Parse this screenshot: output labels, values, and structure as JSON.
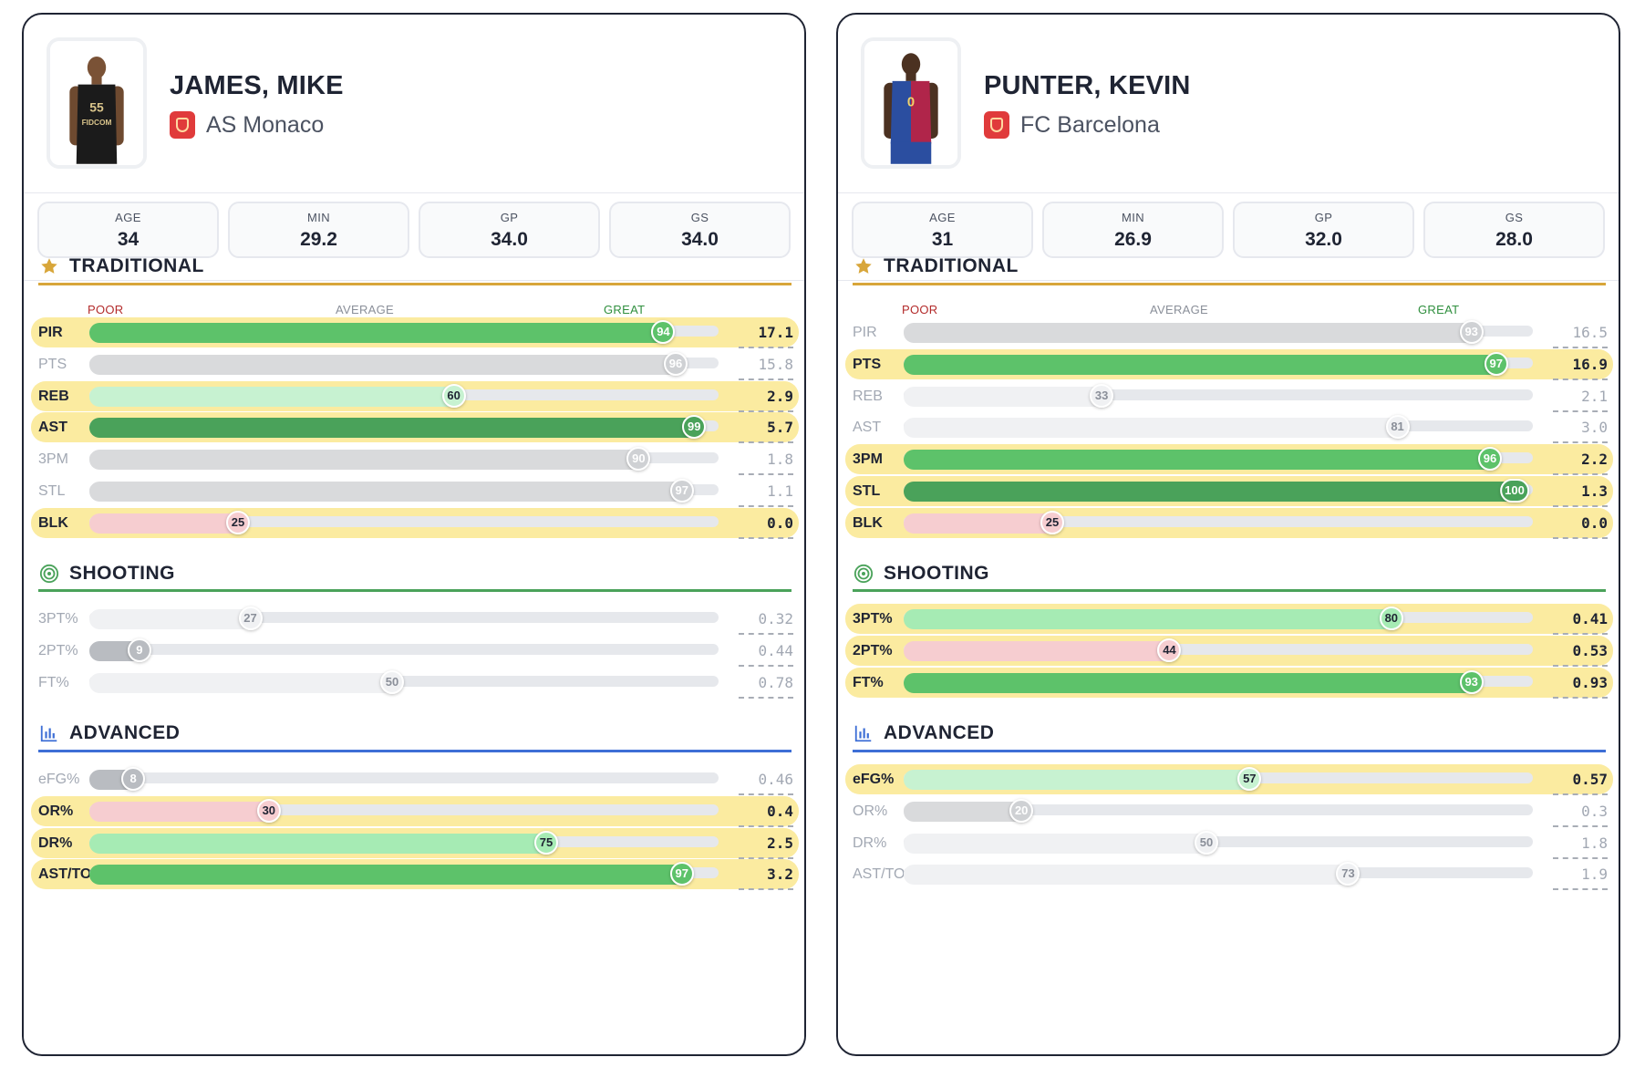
{
  "colors": {
    "great_dark": "#4aa25a",
    "great": "#5dc26a",
    "good": "#a6ebb4",
    "above": "#c7f2d1",
    "poor": "#f6cdd0",
    "neutral": "#d9dadc",
    "neutral_badge": "#cfd1d4",
    "neutral_light": "#f0f1f3",
    "highlight": "#fbeba0",
    "traditional_accent": "#d8a63a",
    "shooting_accent": "#4aa25a",
    "advanced_accent": "#3e6fd6",
    "poor_text": "#b32b2b",
    "great_text": "#2f8f3e",
    "average_text": "#8a8f99"
  },
  "icons": {
    "traditional": "star-icon",
    "shooting": "target-icon",
    "advanced": "bar-chart-icon"
  },
  "players": [
    {
      "name": "JAMES, MIKE",
      "team": "AS Monaco",
      "jersey": "55",
      "jersey_text": "FIDCOM",
      "jersey_color": "#1b1b1b",
      "stats": [
        {
          "label": "AGE",
          "value": "34"
        },
        {
          "label": "MIN",
          "value": "29.2"
        },
        {
          "label": "GP",
          "value": "34.0"
        },
        {
          "label": "GS",
          "value": "34.0"
        }
      ],
      "sections": [
        {
          "key": "traditional",
          "title": "TRADITIONAL",
          "scale": {
            "poor": "POOR",
            "average": "AVERAGE",
            "great": "GREAT"
          },
          "rows": [
            {
              "label": "PIR",
              "pct": 94,
              "value": "17.1",
              "hl": true,
              "tone": "great"
            },
            {
              "label": "PTS",
              "pct": 96,
              "value": "15.8",
              "hl": false,
              "tone": "neutral"
            },
            {
              "label": "REB",
              "pct": 60,
              "value": "2.9",
              "hl": true,
              "tone": "above"
            },
            {
              "label": "AST",
              "pct": 99,
              "value": "5.7",
              "hl": true,
              "tone": "great_dark"
            },
            {
              "label": "3PM",
              "pct": 90,
              "value": "1.8",
              "hl": false,
              "tone": "neutral"
            },
            {
              "label": "STL",
              "pct": 97,
              "value": "1.1",
              "hl": false,
              "tone": "neutral"
            },
            {
              "label": "BLK",
              "pct": 25,
              "value": "0.0",
              "hl": true,
              "tone": "poor"
            }
          ]
        },
        {
          "key": "shooting",
          "title": "SHOOTING",
          "rows": [
            {
              "label": "3PT%",
              "pct": 27,
              "value": "0.32",
              "hl": false,
              "tone": "neutral_light"
            },
            {
              "label": "2PT%",
              "pct": 9,
              "value": "0.44",
              "hl": false,
              "tone": "neutral_dark"
            },
            {
              "label": "FT%",
              "pct": 50,
              "value": "0.78",
              "hl": false,
              "tone": "neutral_light"
            }
          ]
        },
        {
          "key": "advanced",
          "title": "ADVANCED",
          "rows": [
            {
              "label": "eFG%",
              "pct": 8,
              "value": "0.46",
              "hl": false,
              "tone": "neutral_dark"
            },
            {
              "label": "OR%",
              "pct": 30,
              "value": "0.4",
              "hl": true,
              "tone": "poor"
            },
            {
              "label": "DR%",
              "pct": 75,
              "value": "2.5",
              "hl": true,
              "tone": "good"
            },
            {
              "label": "AST/TO",
              "pct": 97,
              "value": "3.2",
              "hl": true,
              "tone": "great"
            }
          ]
        }
      ]
    },
    {
      "name": "PUNTER, KEVIN",
      "team": "FC Barcelona",
      "jersey": "0",
      "jersey_text": "",
      "jersey_color": "#b0254a",
      "stats": [
        {
          "label": "AGE",
          "value": "31"
        },
        {
          "label": "MIN",
          "value": "26.9"
        },
        {
          "label": "GP",
          "value": "32.0"
        },
        {
          "label": "GS",
          "value": "28.0"
        }
      ],
      "sections": [
        {
          "key": "traditional",
          "title": "TRADITIONAL",
          "scale": {
            "poor": "POOR",
            "average": "AVERAGE",
            "great": "GREAT"
          },
          "rows": [
            {
              "label": "PIR",
              "pct": 93,
              "value": "16.5",
              "hl": false,
              "tone": "neutral"
            },
            {
              "label": "PTS",
              "pct": 97,
              "value": "16.9",
              "hl": true,
              "tone": "great"
            },
            {
              "label": "REB",
              "pct": 33,
              "value": "2.1",
              "hl": false,
              "tone": "neutral_light"
            },
            {
              "label": "AST",
              "pct": 81,
              "value": "3.0",
              "hl": false,
              "tone": "neutral_light"
            },
            {
              "label": "3PM",
              "pct": 96,
              "value": "2.2",
              "hl": true,
              "tone": "great"
            },
            {
              "label": "STL",
              "pct": 100,
              "value": "1.3",
              "hl": true,
              "tone": "great_dark"
            },
            {
              "label": "BLK",
              "pct": 25,
              "value": "0.0",
              "hl": true,
              "tone": "poor"
            }
          ]
        },
        {
          "key": "shooting",
          "title": "SHOOTING",
          "rows": [
            {
              "label": "3PT%",
              "pct": 80,
              "value": "0.41",
              "hl": true,
              "tone": "good"
            },
            {
              "label": "2PT%",
              "pct": 44,
              "value": "0.53",
              "hl": true,
              "tone": "poor"
            },
            {
              "label": "FT%",
              "pct": 93,
              "value": "0.93",
              "hl": true,
              "tone": "great"
            }
          ]
        },
        {
          "key": "advanced",
          "title": "ADVANCED",
          "rows": [
            {
              "label": "eFG%",
              "pct": 57,
              "value": "0.57",
              "hl": true,
              "tone": "above"
            },
            {
              "label": "OR%",
              "pct": 20,
              "value": "0.3",
              "hl": false,
              "tone": "neutral"
            },
            {
              "label": "DR%",
              "pct": 50,
              "value": "1.8",
              "hl": false,
              "tone": "neutral_light"
            },
            {
              "label": "AST/TO",
              "pct": 73,
              "value": "1.9",
              "hl": false,
              "tone": "neutral_light"
            }
          ]
        }
      ]
    }
  ]
}
